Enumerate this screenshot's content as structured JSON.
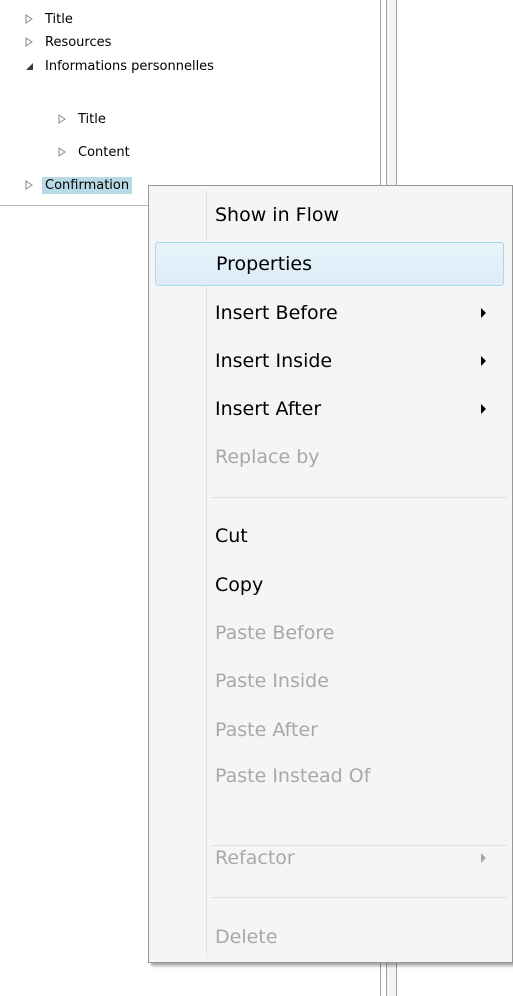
{
  "tree": {
    "items": [
      {
        "label": "Title",
        "icon": "triangle-right-outline-icon"
      },
      {
        "label": "Resources",
        "icon": "triangle-right-outline-icon"
      },
      {
        "label": "Informations personnelles",
        "icon": "triangle-down-filled-icon"
      },
      {
        "label": "Title",
        "icon": "triangle-right-outline-icon"
      },
      {
        "label": "Content",
        "icon": "triangle-right-outline-icon"
      },
      {
        "label": "Confirmation",
        "icon": "triangle-right-outline-icon"
      }
    ]
  },
  "context_menu": {
    "items": [
      {
        "label": "Show in Flow",
        "enabled": true
      },
      {
        "label": "Properties",
        "enabled": true,
        "highlighted": true
      },
      {
        "label": "Insert Before",
        "enabled": true,
        "submenu": true
      },
      {
        "label": "Insert Inside",
        "enabled": true,
        "submenu": true
      },
      {
        "label": "Insert After",
        "enabled": true,
        "submenu": true
      },
      {
        "label": "Replace by",
        "enabled": false
      },
      {
        "label": "Cut",
        "enabled": true
      },
      {
        "label": "Copy",
        "enabled": true
      },
      {
        "label": "Paste Before",
        "enabled": false
      },
      {
        "label": "Paste Inside",
        "enabled": false
      },
      {
        "label": "Paste After",
        "enabled": false
      },
      {
        "label": "Paste Instead Of",
        "enabled": false
      },
      {
        "label": "Refactor",
        "enabled": false,
        "submenu": true
      },
      {
        "label": "Delete",
        "enabled": false
      }
    ]
  },
  "colors": {
    "selection": "#b7dbe6",
    "menu_bg": "#f5f5f5",
    "menu_hover_border": "#a8d8f0",
    "disabled_text": "#a8a8a8"
  }
}
